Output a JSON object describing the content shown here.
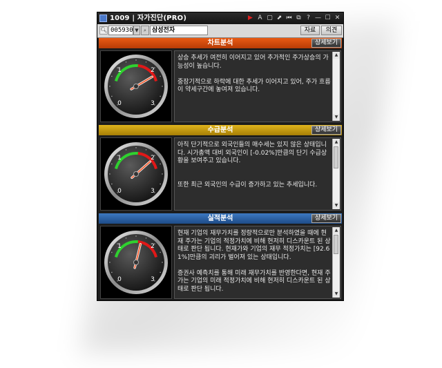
{
  "window": {
    "title": "1009 | 자가진단(PRO)",
    "buttons": [
      "▶",
      "A",
      "▢",
      "⬈",
      "⏮",
      "⧉",
      "?",
      "—",
      "☐",
      "✕"
    ]
  },
  "toolbar": {
    "stock_code": "005930",
    "stock_name": "삼성전자",
    "data_button": "자료",
    "opinion_button": "의견"
  },
  "sections": [
    {
      "title": "차트분석",
      "detail_button": "상세보기",
      "color": "#d04a0c",
      "text": "상승 추세가 여전히 이어지고 있어 추가적인 주가상승의 가능성이 높습니다.\n\n중장기적으로 하락에 대한 추세가 이어지고 있어, 주가 흐름이 약세구간에 놓여져 있습니다.",
      "gauge_level": 0.72
    },
    {
      "title": "수급분석",
      "detail_button": "상세보기",
      "color": "#c89a10",
      "text": "아직 단기적으로 외국인들의 매수세는 있지 않은 상태입니다. 시가총액 대비 외국인이 [-0.02%]만큼의 단기 수급상황을 보여주고 있습니다.\n\n\n또한 최근 외국인의 수급이 증가하고 있는 추세입니다.",
      "gauge_level": 0.68
    },
    {
      "title": "실적분석",
      "detail_button": "상세보기",
      "color": "#2e64a8",
      "text": "현재 기업의 재무가치를 정량적으로만 분석하였을 때에 현재 주가는 기업의 적정가치에 비해 현저히 디스카운트 된 상태로 판단 됩니다. 현재가와 기업의 재무 적정가치는 [92.61%]만큼의 괴리가 벌어져 있는 상태입니다.\n\n증권사 예측치를 통해 미래 재무가치를 반영한다면, 현재 주가는 기업의 미래 적정가치에 비해 현저히 디스카운트 된 상태로 판단 됩니다.",
      "gauge_level": 0.55
    }
  ],
  "gauge_ticks": [
    "0",
    "1",
    "2",
    "3"
  ]
}
